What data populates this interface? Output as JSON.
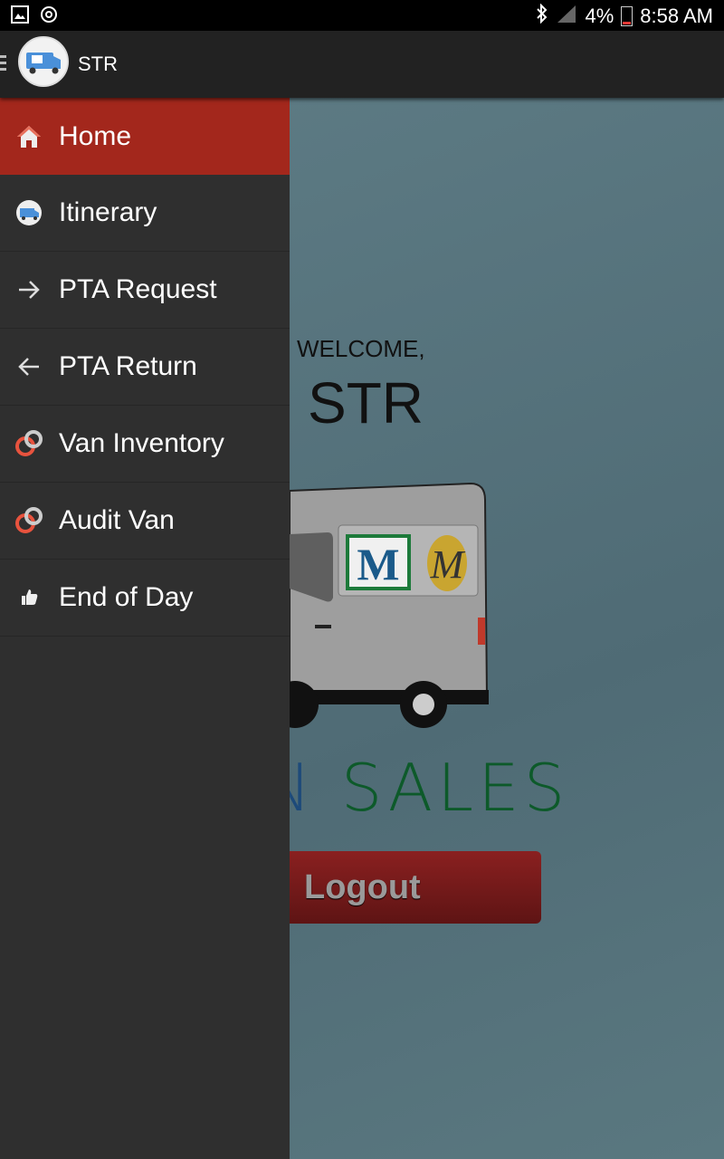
{
  "status_bar": {
    "battery": "4%",
    "time": "8:58 AM"
  },
  "action_bar": {
    "title": "STR"
  },
  "drawer": {
    "items": [
      {
        "label": "Home",
        "icon": "home-icon",
        "active": true
      },
      {
        "label": "Itinerary",
        "icon": "van-logo-icon"
      },
      {
        "label": "PTA Request",
        "icon": "arrow-right-icon"
      },
      {
        "label": "PTA Return",
        "icon": "arrow-left-icon"
      },
      {
        "label": "Van Inventory",
        "icon": "rings-icon"
      },
      {
        "label": "Audit Van",
        "icon": "rings-icon"
      },
      {
        "label": "End of Day",
        "icon": "thumbs-up-icon"
      }
    ]
  },
  "main": {
    "welcome": "WELCOME,",
    "user": "STR",
    "brand_tail_n": "N",
    "brand_sales": "SALES",
    "logout_label": "Logout",
    "van_logo_letter": "M",
    "van_logo_script": "M"
  },
  "colors": {
    "accent": "#a3271c",
    "drawer_bg": "#2f2f2f",
    "brand_green": "#0d5a2a",
    "brand_blue": "#1d4a7a"
  }
}
